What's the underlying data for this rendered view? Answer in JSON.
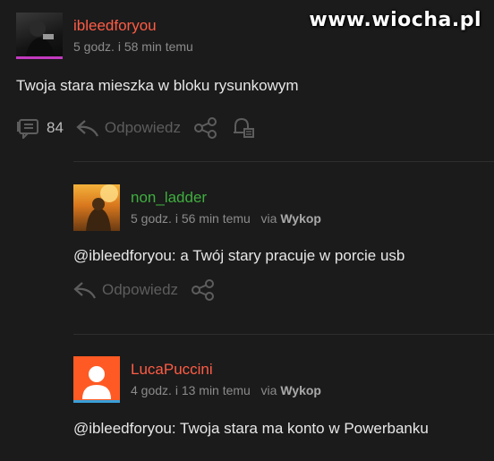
{
  "watermark": "www.wiocha.pl",
  "comments": [
    {
      "username": "ibleedforyou",
      "username_color": "#ff5c45",
      "time": "5 godz. i 58 min temu",
      "via": "",
      "text": "Twoja stara mieszka w bloku rysunkowym",
      "votes": "84",
      "reply_label": "Odpowiedz",
      "underline_color": "#c23bc0"
    },
    {
      "username": "non_ladder",
      "username_color": "#3fae3f",
      "time": "5 godz. i 56 min temu",
      "via_prefix": "via",
      "via_app": "Wykop",
      "text": "@ibleedforyou: a Twój stary pracuje w porcie usb",
      "reply_label": "Odpowiedz"
    },
    {
      "username": "LucaPuccini",
      "username_color": "#ff5c45",
      "time": "4 godz. i 13 min temu",
      "via_prefix": "via",
      "via_app": "Wykop",
      "text": "@ibleedforyou: Twoja stara ma konto w Powerbanku",
      "underline_color": "#3aa0d8"
    }
  ],
  "icons": {
    "votes": "comment-count-icon",
    "reply": "reply-arrow-icon",
    "share": "share-icon",
    "notify": "bell-icon"
  }
}
